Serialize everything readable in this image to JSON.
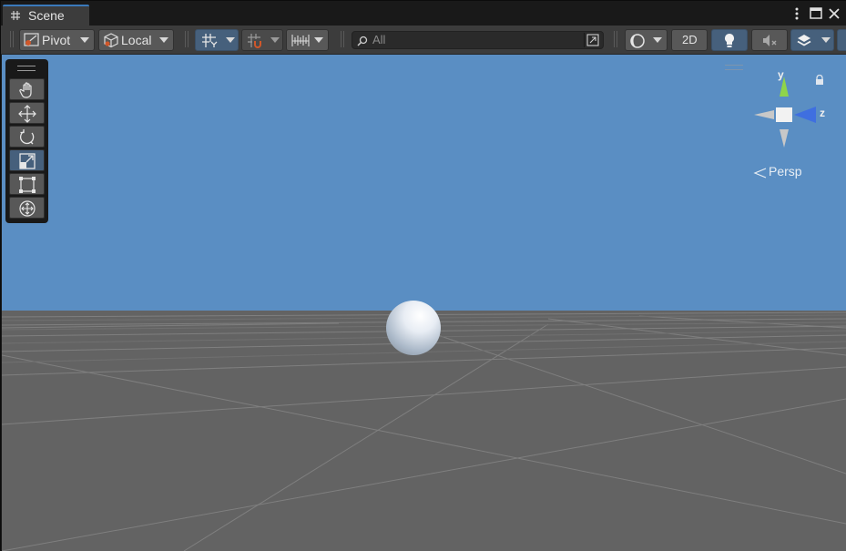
{
  "tab": {
    "title": "Scene",
    "icon": "grid-hash-icon"
  },
  "window_controls": [
    "kebab-menu-icon",
    "maximize-icon",
    "close-icon"
  ],
  "toolbar": {
    "pivot_label": "Pivot",
    "local_label": "Local",
    "search_placeholder": "All",
    "mode_2d_label": "2D"
  },
  "tools": [
    {
      "name": "hand-tool",
      "icon": "hand-icon",
      "active": false
    },
    {
      "name": "move-tool",
      "icon": "move-arrows-icon",
      "active": false
    },
    {
      "name": "rotate-tool",
      "icon": "rotate-icon",
      "active": false
    },
    {
      "name": "scale-tool",
      "icon": "scale-icon",
      "active": true
    },
    {
      "name": "rect-tool",
      "icon": "rect-transform-icon",
      "active": false
    },
    {
      "name": "transform-tool",
      "icon": "transform-icon",
      "active": false
    }
  ],
  "gizmo": {
    "y_label": "y",
    "z_label": "z",
    "projection_label": "Persp"
  },
  "colors": {
    "sky": "#5a8ec3",
    "ground": "#636363",
    "accent": "#46607c",
    "y_axis": "#8fd44a",
    "z_axis": "#3f6fe0"
  }
}
